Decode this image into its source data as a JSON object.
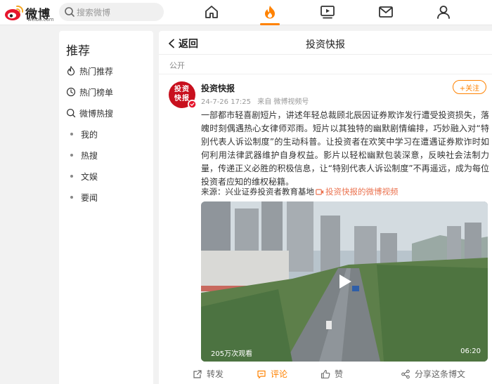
{
  "logo": {
    "cn": "微博",
    "en": "weibo.com"
  },
  "search": {
    "placeholder": "搜索微博"
  },
  "nav": [
    "home-icon",
    "hot-fire-icon",
    "video-play-icon",
    "mail-icon",
    "profile-icon"
  ],
  "colors": {
    "accent": "#ff8200",
    "brand_red": "#e6162d",
    "link": "#eb7350"
  },
  "sidebar": {
    "title": "推荐",
    "items": [
      {
        "label": "热门推荐",
        "icon": "fire-icon"
      },
      {
        "label": "热门榜单",
        "icon": "clock-icon"
      },
      {
        "label": "微博热搜",
        "icon": "search-icon"
      },
      {
        "label": "我的"
      },
      {
        "label": "热搜"
      },
      {
        "label": "文娱"
      },
      {
        "label": "要闻"
      }
    ]
  },
  "header": {
    "back": "返回",
    "title": "投资快报"
  },
  "post": {
    "visibility": "公开",
    "avatar_text": "投资快报",
    "author": "投资快报",
    "time": "24-7-26 17:25",
    "via": "来自 微博视频号",
    "follow": "+关注",
    "text": "一部都市轻喜剧短片，讲述年轻总裁顾北辰因证券欺诈发行遭受投资损失，落魄时刻偶遇热心女律师邓雨。短片以其独特的幽默剧情编排，巧妙融入对“特别代表人诉讼制度”的生动科普。让投资者在欢笑中学习在遭遇证券欺诈时如何利用法律武器维护自身权益。影片以轻松幽默包装深意，反映社会法制力量，传递正义必胜的积极信息，让“特别代表人诉讼制度”不再遥远，成为每位投资者应知的维权秘籍。",
    "source_label": "来源：兴业证券投资者教育基地",
    "source_link": "投资快报的微博视频",
    "video": {
      "views": "205万次观看",
      "duration": "06:20"
    },
    "actions": {
      "repost": "转发",
      "comment": "评论",
      "like": "赞",
      "share": "分享这条博文"
    }
  }
}
